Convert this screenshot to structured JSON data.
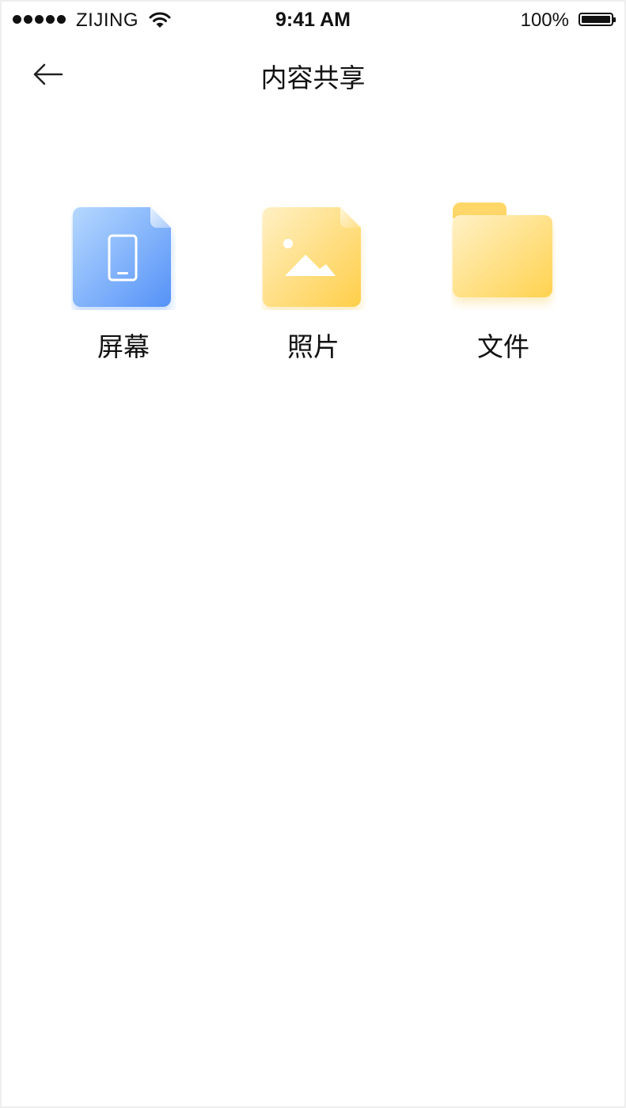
{
  "status_bar": {
    "carrier": "ZIJING",
    "time": "9:41 AM",
    "battery": "100%"
  },
  "nav": {
    "title": "内容共享",
    "back_icon": "arrow-left-icon"
  },
  "options": [
    {
      "label": "屏幕",
      "icon": "screen-file-icon",
      "color": "#5b9bfc"
    },
    {
      "label": "照片",
      "icon": "photo-file-icon",
      "color": "#ffd45c"
    },
    {
      "label": "文件",
      "icon": "folder-icon",
      "color": "#ffd45c"
    }
  ]
}
